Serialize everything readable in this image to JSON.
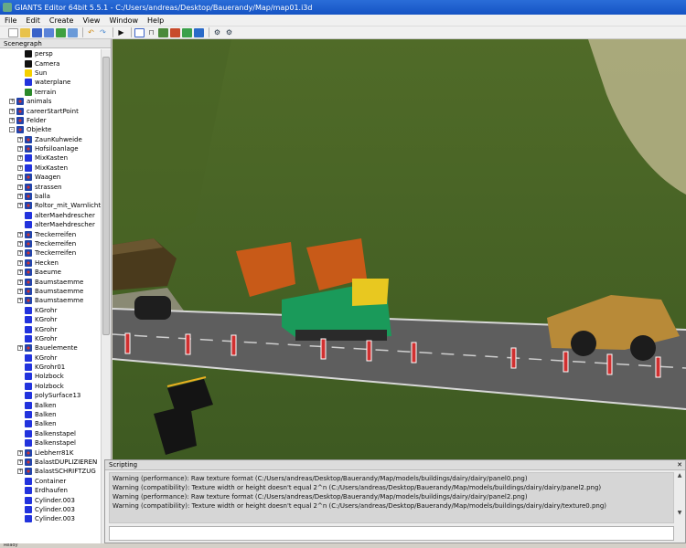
{
  "window": {
    "title": "GIANTS Editor 64bit 5.5.1 - C:/Users/andreas/Desktop/Bauerandy/Map/map01.i3d"
  },
  "menu": [
    "File",
    "Edit",
    "Create",
    "View",
    "Window",
    "Help"
  ],
  "toolbar": {
    "icons": [
      "new-icon",
      "open-icon",
      "save-icon",
      "save-as-icon",
      "reload-icon",
      "export-icon",
      "undo-icon",
      "redo-icon",
      "play-icon",
      "select-mode-icon",
      "move-icon",
      "terrain-sculpt-icon",
      "paint-icon",
      "foliage-paint-icon",
      "texture-paint-icon",
      "settings-icon",
      "settings-alt-icon"
    ]
  },
  "scenegraph": {
    "header": "Scenegraph",
    "nodes": [
      {
        "label": "persp",
        "icon": "camera",
        "level": 1,
        "expander": ""
      },
      {
        "label": "Camera",
        "icon": "camera",
        "level": 1,
        "expander": ""
      },
      {
        "label": "Sun",
        "icon": "sun",
        "level": 1,
        "expander": ""
      },
      {
        "label": "waterplane",
        "icon": "cube",
        "level": 1,
        "expander": ""
      },
      {
        "label": "terrain",
        "icon": "terrain",
        "level": 1,
        "expander": ""
      },
      {
        "label": "animals",
        "icon": "group",
        "level": 0,
        "expander": "+"
      },
      {
        "label": "careerStartPoint",
        "icon": "group",
        "level": 0,
        "expander": "+"
      },
      {
        "label": "Felder",
        "icon": "group",
        "level": 0,
        "expander": "+"
      },
      {
        "label": "Objekte",
        "icon": "group",
        "level": 0,
        "expander": "-"
      },
      {
        "label": "ZaunKuhweide",
        "icon": "group",
        "level": 1,
        "expander": "+"
      },
      {
        "label": "Hofsiloanlage",
        "icon": "group",
        "level": 1,
        "expander": "+"
      },
      {
        "label": "MixKasten",
        "icon": "cube",
        "level": 1,
        "expander": "+"
      },
      {
        "label": "MixKasten",
        "icon": "cube",
        "level": 1,
        "expander": "+"
      },
      {
        "label": "Waagen",
        "icon": "group",
        "level": 1,
        "expander": "+"
      },
      {
        "label": "strassen",
        "icon": "group",
        "level": 1,
        "expander": "+"
      },
      {
        "label": "balla",
        "icon": "group",
        "level": 1,
        "expander": "+"
      },
      {
        "label": "Roltor_mit_Warnlicht",
        "icon": "group",
        "level": 1,
        "expander": "+"
      },
      {
        "label": "alterMaehdrescher",
        "icon": "cube",
        "level": 1,
        "expander": ""
      },
      {
        "label": "alterMaehdrescher",
        "icon": "cube",
        "level": 1,
        "expander": ""
      },
      {
        "label": "Treckerreifen",
        "icon": "group",
        "level": 1,
        "expander": "+"
      },
      {
        "label": "Treckerreifen",
        "icon": "group",
        "level": 1,
        "expander": "+"
      },
      {
        "label": "Treckerreifen",
        "icon": "group",
        "level": 1,
        "expander": "+"
      },
      {
        "label": "Hecken",
        "icon": "group",
        "level": 1,
        "expander": "+"
      },
      {
        "label": "Baeume",
        "icon": "group",
        "level": 1,
        "expander": "+"
      },
      {
        "label": "Baumstaemme",
        "icon": "group",
        "level": 1,
        "expander": "+"
      },
      {
        "label": "Baumstaemme",
        "icon": "group",
        "level": 1,
        "expander": "+"
      },
      {
        "label": "Baumstaemme",
        "icon": "group",
        "level": 1,
        "expander": "+"
      },
      {
        "label": "KGrohr",
        "icon": "cube",
        "level": 1,
        "expander": ""
      },
      {
        "label": "KGrohr",
        "icon": "cube",
        "level": 1,
        "expander": ""
      },
      {
        "label": "KGrohr",
        "icon": "cube",
        "level": 1,
        "expander": ""
      },
      {
        "label": "KGrohr",
        "icon": "cube",
        "level": 1,
        "expander": ""
      },
      {
        "label": "Bauelemente",
        "icon": "group",
        "level": 1,
        "expander": "+"
      },
      {
        "label": "KGrohr",
        "icon": "cube",
        "level": 1,
        "expander": ""
      },
      {
        "label": "KGrohr01",
        "icon": "cube",
        "level": 1,
        "expander": ""
      },
      {
        "label": "Holzbock",
        "icon": "cube",
        "level": 1,
        "expander": ""
      },
      {
        "label": "Holzbock",
        "icon": "cube",
        "level": 1,
        "expander": ""
      },
      {
        "label": "polySurface13",
        "icon": "cube",
        "level": 1,
        "expander": ""
      },
      {
        "label": "Balken",
        "icon": "cube",
        "level": 1,
        "expander": ""
      },
      {
        "label": "Balken",
        "icon": "cube",
        "level": 1,
        "expander": ""
      },
      {
        "label": "Balken",
        "icon": "cube",
        "level": 1,
        "expander": ""
      },
      {
        "label": "Balkenstapel",
        "icon": "cube",
        "level": 1,
        "expander": ""
      },
      {
        "label": "Balkenstapel",
        "icon": "cube",
        "level": 1,
        "expander": ""
      },
      {
        "label": "Liebherr81K",
        "icon": "group",
        "level": 1,
        "expander": "+"
      },
      {
        "label": "BalastDUPLIZIEREN",
        "icon": "group",
        "level": 1,
        "expander": "+"
      },
      {
        "label": "BalastSCHRIFTZUG",
        "icon": "group",
        "level": 1,
        "expander": "+"
      },
      {
        "label": "Container",
        "icon": "cube",
        "level": 1,
        "expander": ""
      },
      {
        "label": "Erdhaufen",
        "icon": "cube",
        "level": 1,
        "expander": ""
      },
      {
        "label": "Cylinder.003",
        "icon": "cube",
        "level": 1,
        "expander": ""
      },
      {
        "label": "Cylinder.003",
        "icon": "cube",
        "level": 1,
        "expander": ""
      },
      {
        "label": "Cylinder.003",
        "icon": "cube",
        "level": 1,
        "expander": ""
      }
    ]
  },
  "scripting": {
    "header": "Scripting",
    "lines": [
      "Warning (performance): Raw texture format (C:/Users/andreas/Desktop/Bauerandy/Map/models/buildings/dairy/dairy/panel0.png)",
      "Warning (compatibility): Texture width or height doesn't equal 2^n (C:/Users/andreas/Desktop/Bauerandy/Map/models/buildings/dairy/dairy/panel2.png)",
      "Warning (performance): Raw texture format (C:/Users/andreas/Desktop/Bauerandy/Map/models/buildings/dairy/dairy/panel2.png)",
      "Warning (compatibility): Texture width or height doesn't equal 2^n (C:/Users/andreas/Desktop/Bauerandy/Map/models/buildings/dairy/dairy/texture0.png)"
    ]
  },
  "status": "Ready"
}
